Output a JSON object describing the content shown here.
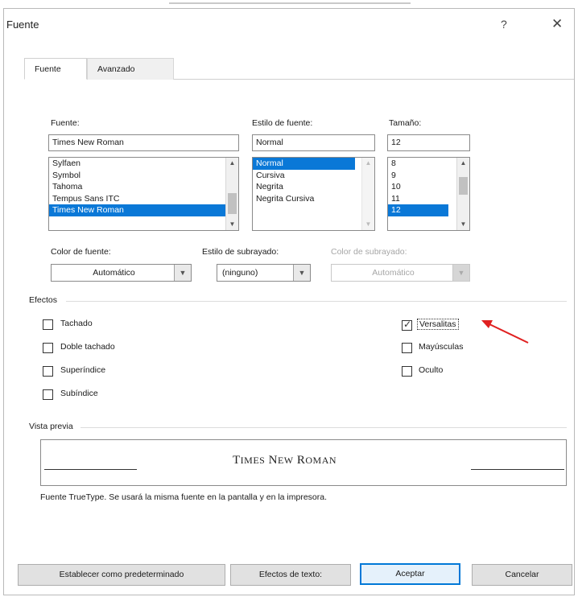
{
  "window": {
    "title": "Fuente",
    "help_glyph": "?",
    "close_glyph": "✕"
  },
  "tabs": [
    {
      "label": "Fuente",
      "active": true
    },
    {
      "label": "Avanzado",
      "active": false
    }
  ],
  "font": {
    "label": "Fuente:",
    "value": "Times New Roman",
    "list": [
      "Sylfaen",
      "Symbol",
      "Tahoma",
      "Tempus Sans ITC",
      "Times New Roman"
    ],
    "selected_index": 4
  },
  "style": {
    "label": "Estilo de fuente:",
    "value": "Normal",
    "list": [
      "Normal",
      "Cursiva",
      "Negrita",
      "Negrita Cursiva"
    ],
    "selected_index": 0
  },
  "size": {
    "label": "Tamaño:",
    "value": "12",
    "list": [
      "8",
      "9",
      "10",
      "11",
      "12"
    ],
    "selected_index": 4
  },
  "font_color": {
    "label": "Color de fuente:",
    "value": "Automático"
  },
  "underline_style": {
    "label": "Estilo de subrayado:",
    "value": "(ninguno)"
  },
  "underline_color": {
    "label": "Color de subrayado:",
    "value": "Automático",
    "disabled": true
  },
  "effects": {
    "label": "Efectos",
    "left": [
      {
        "label": "Tachado",
        "checked": false
      },
      {
        "label": "Doble tachado",
        "checked": false
      },
      {
        "label": "Superíndice",
        "checked": false
      },
      {
        "label": "Subíndice",
        "checked": false
      }
    ],
    "right": [
      {
        "label": "Versalitas",
        "checked": true
      },
      {
        "label": "Mayúsculas",
        "checked": false
      },
      {
        "label": "Oculto",
        "checked": false
      }
    ]
  },
  "preview": {
    "label": "Vista previa",
    "sample_big_1": "T",
    "sample_small_1": "IMES",
    "sample_big_2": "N",
    "sample_small_2": "EW",
    "sample_big_3": "R",
    "sample_small_3": "OMAN",
    "note": "Fuente TrueType. Se usará la misma fuente en la pantalla y en la impresora."
  },
  "buttons": {
    "set_default": "Establecer como predeterminado",
    "text_effects": "Efectos de texto:",
    "ok": "Aceptar",
    "cancel": "Cancelar"
  },
  "colors": {
    "selection": "#0a78d7",
    "annotation_arrow": "#e02020",
    "primary_border": "#0078d7"
  },
  "icons": {
    "scroll_up": "chevron-up-icon",
    "scroll_down": "chevron-down-icon",
    "dropdown": "dropdown-arrow-icon",
    "annotation": "red-arrow-icon"
  }
}
